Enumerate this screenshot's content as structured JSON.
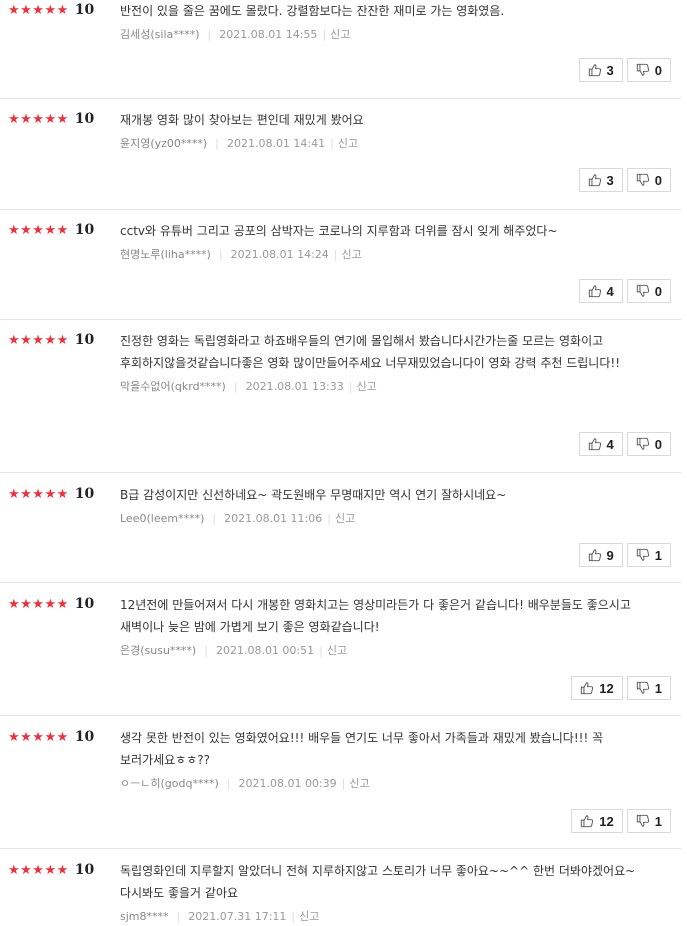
{
  "reviews": [
    {
      "stars": "★★★★★",
      "score": "10",
      "text": "반전이 있을 줄은 꿈에도 몰랐다. 강렬함보다는 잔잔한 재미로 가는 영화였음.",
      "author": "김세성(sila****)",
      "date": "2021.08.01 14:55",
      "report": "신고",
      "likes": "3",
      "dislikes": "0"
    },
    {
      "stars": "★★★★★",
      "score": "10",
      "text": "재개봉 영화 많이 찾아보는 편인데 재밌게 봤어요",
      "author": "윤지영(yz00****)",
      "date": "2021.08.01 14:41",
      "report": "신고",
      "likes": "3",
      "dislikes": "0"
    },
    {
      "stars": "★★★★★",
      "score": "10",
      "text": "cctv와 유튜버 그리고 공포의 삼박자는 코로나의 지루함과 더위를 잠시 잊게 해주었다~",
      "author": "현명노루(liha****)",
      "date": "2021.08.01 14:24",
      "report": "신고",
      "likes": "4",
      "dislikes": "0"
    },
    {
      "stars": "★★★★★",
      "score": "10",
      "text": "진정한 영화는 독립영화라고 하죠배우들의 연기에 몰입해서 봤습니다시간가는줄 모르는 영화이고 후회하지않을것같습니다좋은 영화 많이만들어주세요 너무재밌었습니다이 영화 강력 추천 드립니다!!",
      "author": "막을수없어(qkrd****)",
      "date": "2021.08.01 13:33",
      "report": "신고",
      "likes": "4",
      "dislikes": "0"
    },
    {
      "stars": "★★★★★",
      "score": "10",
      "text": "B급 감성이지만 신선하네요~ 곽도원배우 무명때지만 역시 연기 잘하시네요~",
      "author": "Lee0(leem****)",
      "date": "2021.08.01 11:06",
      "report": "신고",
      "likes": "9",
      "dislikes": "1"
    },
    {
      "stars": "★★★★★",
      "score": "10",
      "text": "12년전에 만들어져서 다시 개봉한 영화치고는 영상미라든가 다 좋은거 같습니다! 배우분들도 좋으시고 새벽이나 늦은 밤에 가볍게 보기 좋은 영화같습니다!",
      "author": "은경(susu****)",
      "date": "2021.08.01 00:51",
      "report": "신고",
      "likes": "12",
      "dislikes": "1"
    },
    {
      "stars": "★★★★★",
      "score": "10",
      "text": "생각 못한 반전이 있는 영화였어요!!! 배우들 연기도 너무 좋아서 가족들과 재밌게 봤습니다!!! 꼭 보러가세요ㅎㅎ??",
      "author": "ㅇㅡㄴ히(godq****)",
      "date": "2021.08.01 00:39",
      "report": "신고",
      "likes": "12",
      "dislikes": "1"
    },
    {
      "stars": "★★★★★",
      "score": "10",
      "text": "독립영화인데 지루할지 알았더니 전혀 지루하지않고 스토리가 너무 좋아요~~^^ 한번 더봐야겠어요~ 다시봐도 좋을거 같아요",
      "author": "sjm8****",
      "date": "2021.07.31 17:11",
      "report": "신고",
      "likes": "",
      "dislikes": ""
    }
  ],
  "colors": {
    "star": "#f0303b",
    "border": "#d9d9d9",
    "divider": "#e5e5e5"
  },
  "icons": {
    "like": "thumbs-up-icon",
    "dislike": "thumbs-down-icon"
  }
}
